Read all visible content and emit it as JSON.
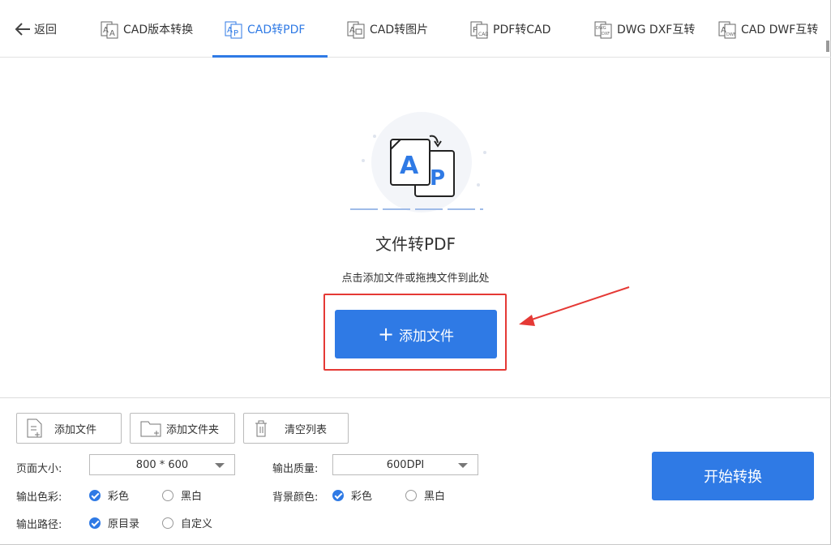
{
  "nav": {
    "back_label": "返回",
    "tabs": [
      {
        "label": "CAD版本转换",
        "icon": "cad-version-icon"
      },
      {
        "label": "CAD转PDF",
        "icon": "cad-to-pdf-icon",
        "active": true
      },
      {
        "label": "CAD转图片",
        "icon": "cad-to-image-icon"
      },
      {
        "label": "PDF转CAD",
        "icon": "pdf-to-cad-icon"
      },
      {
        "label": "DWG DXF互转",
        "icon": "dwg-dxf-icon"
      },
      {
        "label": "CAD DWF互转",
        "icon": "cad-dwf-icon"
      }
    ]
  },
  "main": {
    "title": "文件转PDF",
    "hint": "点击添加文件或拖拽文件到此处",
    "add_button_label": "添加文件",
    "hero_letters": {
      "a": "A",
      "p": "P"
    }
  },
  "toolbar": {
    "add_file_label": "添加文件",
    "add_folder_label": "添加文件夹",
    "clear_list_label": "清空列表"
  },
  "settings": {
    "page_size_label": "页面大小:",
    "page_size_value": "800 * 600",
    "quality_label": "输出质量:",
    "quality_value": "600DPI",
    "color_label": "输出色彩:",
    "color_options": [
      "彩色",
      "黑白"
    ],
    "color_selected": "彩色",
    "bg_label": "背景颜色:",
    "bg_options": [
      "彩色",
      "黑白"
    ],
    "bg_selected": "彩色",
    "path_label": "输出路径:",
    "path_options": [
      "原目录",
      "自定义"
    ],
    "path_selected": "原目录"
  },
  "start_button_label": "开始转换",
  "colors": {
    "accent": "#2f7ae5",
    "highlight": "#e53935"
  }
}
